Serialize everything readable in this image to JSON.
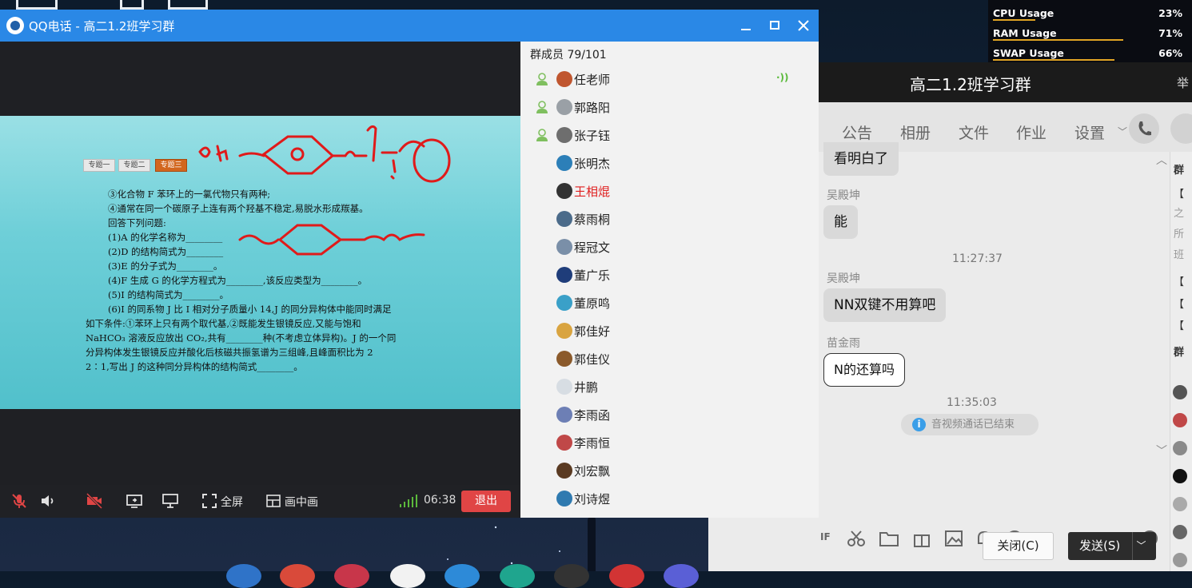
{
  "sysmon": {
    "rows": [
      {
        "label": "CPU Usage",
        "value": "23%",
        "fraction": 0.23
      },
      {
        "label": "RAM Usage",
        "value": "71%",
        "fraction": 0.71
      },
      {
        "label": "SWAP Usage",
        "value": "66%",
        "fraction": 0.66
      }
    ]
  },
  "call_window": {
    "title": "QQ电话 - 高二1.2班学习群",
    "accent": "#2a88e6",
    "controls": {
      "fullscreen_label": "全屏",
      "pip_label": "画中画",
      "timer": "06:38",
      "exit_label": "退出"
    },
    "slide": {
      "tabs": [
        "专题一",
        "专题二",
        "专题三"
      ],
      "lines": [
        "③化合物 F 苯环上的一氯代物只有两种;",
        "④通常在同一个碳原子上连有两个羟基不稳定,易脱水形成羰基。",
        "回答下列问题:",
        "(1)A 的化学名称为________",
        "(2)D 的结构简式为________",
        "(3)E 的分子式为________。",
        "(4)F 生成 G 的化学方程式为________,该反应类型为________。",
        "(5)I 的结构简式为________。",
        "(6)I 的同系物 J 比 I 相对分子质量小 14,J 的同分异构体中能同时满足",
        "如下条件:①苯环上只有两个取代基,②既能发生银镜反应,又能与饱和",
        "NaHCO₃ 溶液反应放出 CO₂,共有________种(不考虑立体异构)。J 的一个同",
        "分异构体发生银镜反应并酸化后核磁共振氢谱为三组峰,且峰面积比为 2",
        "2∶1,写出 J 的这种同分异构体的结构简式________。"
      ]
    },
    "members": {
      "header": "群成员 79/101",
      "list": [
        {
          "name": "任老师",
          "host": true,
          "speaking": true,
          "color": "#222",
          "avatar": "#c0562f"
        },
        {
          "name": "郭路阳",
          "host": true,
          "speaking": false,
          "color": "#222",
          "avatar": "#9aa0a6"
        },
        {
          "name": "张子钰",
          "host": true,
          "speaking": false,
          "color": "#222",
          "avatar": "#6e6e6e"
        },
        {
          "name": "张明杰",
          "host": false,
          "speaking": false,
          "color": "#222",
          "avatar": "#2c7fb8"
        },
        {
          "name": "王相焜",
          "host": false,
          "speaking": false,
          "color": "#e02020",
          "avatar": "#333"
        },
        {
          "name": "蔡雨桐",
          "host": false,
          "speaking": false,
          "color": "#222",
          "avatar": "#4b6b8a"
        },
        {
          "name": "程冠文",
          "host": false,
          "speaking": false,
          "color": "#222",
          "avatar": "#7a8fa8"
        },
        {
          "name": "董广乐",
          "host": false,
          "speaking": false,
          "color": "#222",
          "avatar": "#1f3d7a"
        },
        {
          "name": "董原鸣",
          "host": false,
          "speaking": false,
          "color": "#222",
          "avatar": "#3aa0c8"
        },
        {
          "name": "郭佳好",
          "host": false,
          "speaking": false,
          "color": "#222",
          "avatar": "#d9a440"
        },
        {
          "name": "郭佳仪",
          "host": false,
          "speaking": false,
          "color": "#222",
          "avatar": "#8b5a2b"
        },
        {
          "name": "井鹏",
          "host": false,
          "speaking": false,
          "color": "#222",
          "avatar": "#d7dde3"
        },
        {
          "name": "李雨函",
          "host": false,
          "speaking": false,
          "color": "#222",
          "avatar": "#6d7fb5"
        },
        {
          "name": "李雨恒",
          "host": false,
          "speaking": false,
          "color": "#222",
          "avatar": "#c04848"
        },
        {
          "name": "刘宏飘",
          "host": false,
          "speaking": false,
          "color": "#222",
          "avatar": "#5a3a22"
        },
        {
          "name": "刘诗煜",
          "host": false,
          "speaking": false,
          "color": "#222",
          "avatar": "#2f7ab0"
        }
      ]
    }
  },
  "chat_window": {
    "title": "高二1.2班学习群",
    "title_extra": "举",
    "tabs": [
      "公告",
      "相册",
      "文件",
      "作业",
      "设置"
    ],
    "messages": {
      "m0": "看明白了",
      "s1": "吴殿坤",
      "m1": "能",
      "t1": "11:27:37",
      "s2": "吴殿坤",
      "m2": "NN双键不用算吧",
      "s3": "苗金雨",
      "m3": "N的还算吗",
      "t2": "11:35:03",
      "notice": "音视频通话已结束"
    },
    "buttons": {
      "close": "关闭(C)",
      "send": "发送(S)"
    },
    "sidebar_text": [
      "群",
      "【",
      "之",
      "所",
      "班",
      "【",
      "【",
      "【",
      "群"
    ]
  }
}
